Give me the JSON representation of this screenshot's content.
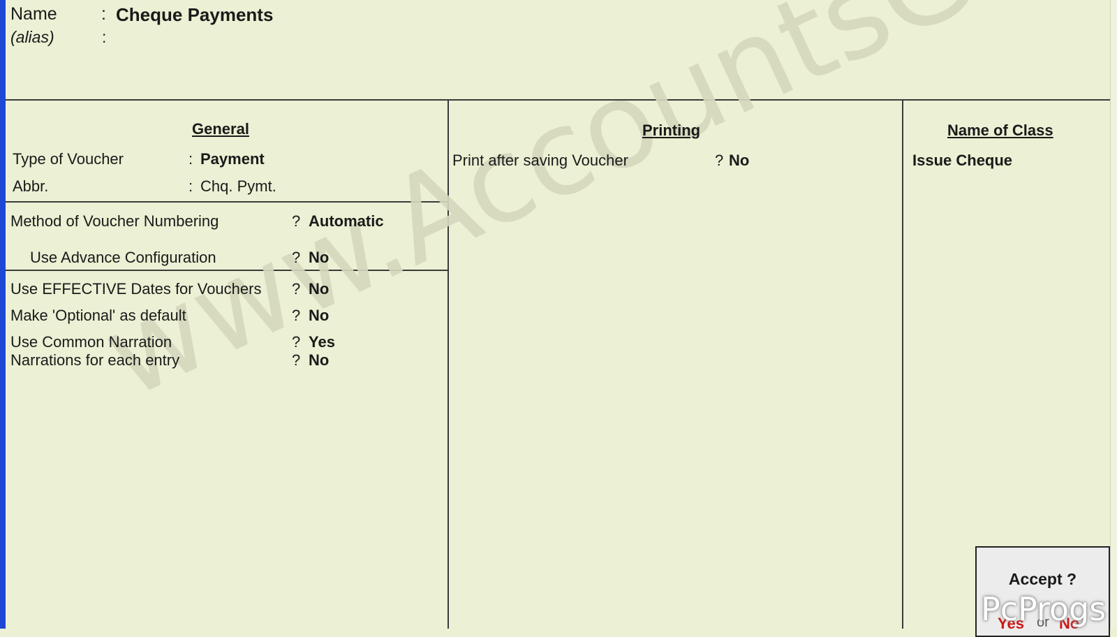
{
  "header": {
    "name_label": "Name",
    "name_sep": ":",
    "name_value": "Cheque Payments",
    "alias_label": "(alias)",
    "alias_sep": ":"
  },
  "general": {
    "heading": "General",
    "type_label": "Type of Voucher",
    "type_sep": ":",
    "type_value": "Payment",
    "abbr_label": "Abbr.",
    "abbr_sep": ":",
    "abbr_value": "Chq. Pymt.",
    "numbering_label": "Method of Voucher Numbering",
    "numbering_q": "?",
    "numbering_value": "Automatic",
    "advance_label": "Use Advance Configuration",
    "advance_q": "?",
    "advance_value": "No",
    "effective_label": "Use EFFECTIVE Dates for Vouchers",
    "effective_q": "?",
    "effective_value": "No",
    "optional_label": "Make 'Optional' as default",
    "optional_q": "?",
    "optional_value": "No",
    "common_label": "Use Common Narration",
    "common_q": "?",
    "common_value": "Yes",
    "each_label": "Narrations for each entry",
    "each_q": "?",
    "each_value": "No"
  },
  "printing": {
    "heading": "Printing",
    "print_label": "Print after saving Voucher",
    "print_q": "?",
    "print_value": "No"
  },
  "class": {
    "heading": "Name of Class",
    "value": "Issue Cheque"
  },
  "accept": {
    "title": "Accept ?",
    "yes": "Yes",
    "or": "or",
    "no": "No"
  },
  "watermark": "www.AccountsGuy.Net",
  "overlay_logo": "PcProgs",
  "colors": {
    "background": "#ecf0d4",
    "left_edge": "#1f47d6",
    "accept_choice": "#d01515"
  }
}
